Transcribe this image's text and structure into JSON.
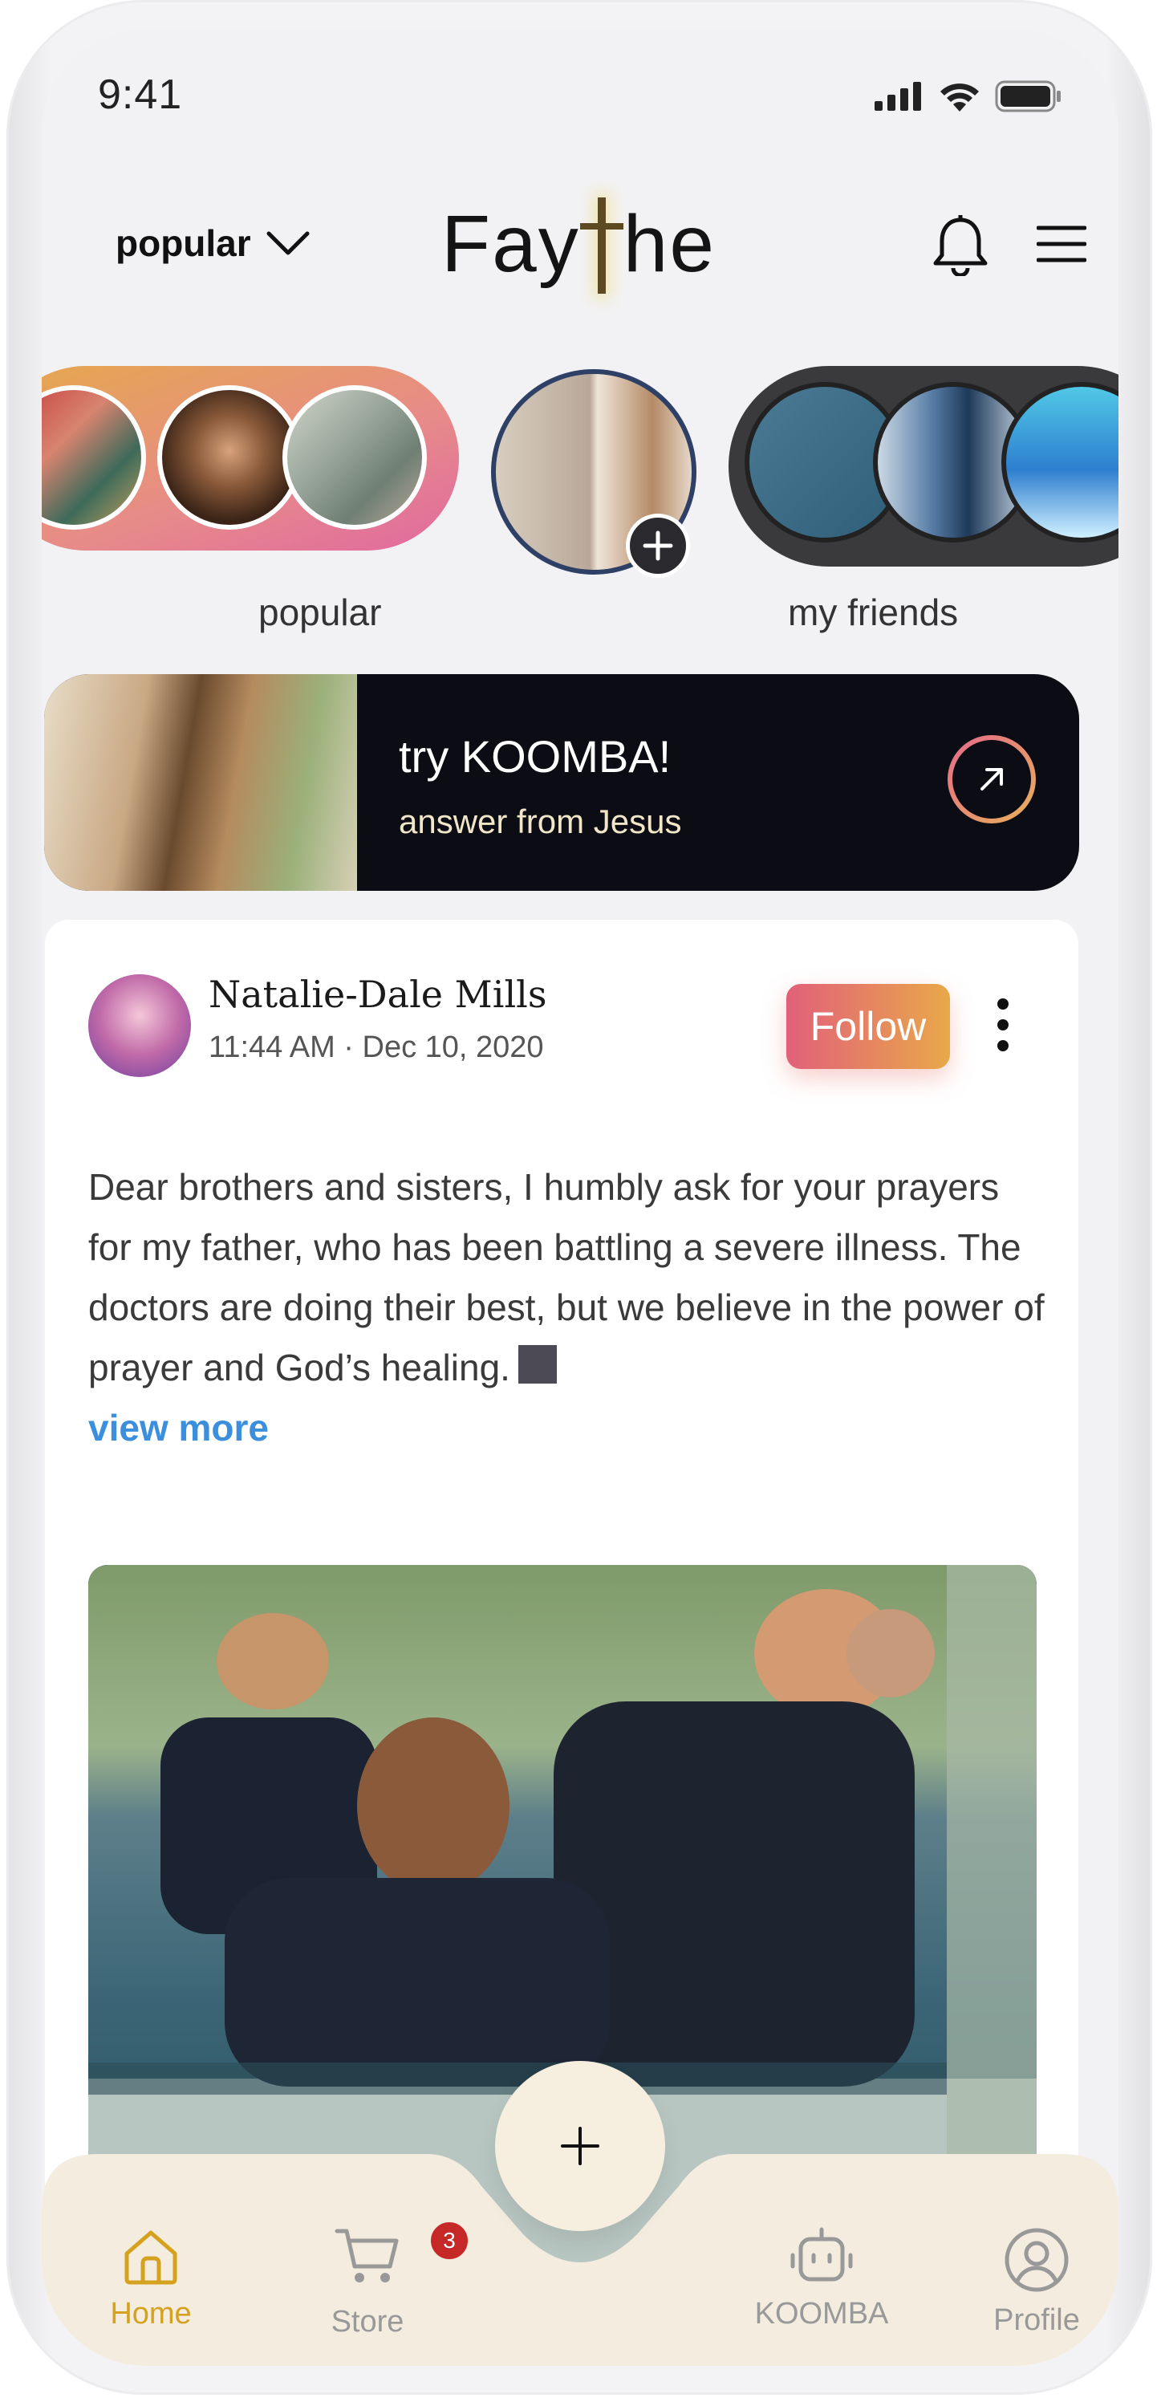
{
  "status_bar": {
    "time": "9:41"
  },
  "header": {
    "feed_selector": "popular",
    "logo_before": "Fay",
    "logo_after": "he"
  },
  "stories": {
    "groups": [
      {
        "label": "popular"
      },
      {
        "label": "my friends"
      }
    ]
  },
  "promo": {
    "title": "try KOOMBA!",
    "subtitle": "answer from Jesus"
  },
  "post": {
    "author": "Natalie-Dale Mills",
    "timestamp": "11:44 AM · Dec 10, 2020",
    "follow_label": "Follow",
    "text": "Dear brothers and sisters, I humbly ask for your prayers for my father, who has been battling a severe illness. The doctors are doing their best, but we believe in the power of prayer and God’s healing.",
    "view_more": "view more"
  },
  "tabbar": {
    "items": [
      {
        "label": "Home",
        "icon": "home-icon",
        "active": true
      },
      {
        "label": "Store",
        "icon": "cart-icon",
        "badge": "3"
      },
      {
        "label": "KOOMBA",
        "icon": "robot-icon"
      },
      {
        "label": "Profile",
        "icon": "user-icon"
      }
    ],
    "fab_icon": "plus-icon"
  },
  "colors": {
    "accent_gradient_start": "#e2607a",
    "accent_gradient_end": "#e9a84a",
    "active_tab": "#d4a21e",
    "link": "#3b8fdc",
    "badge": "#c62828"
  }
}
